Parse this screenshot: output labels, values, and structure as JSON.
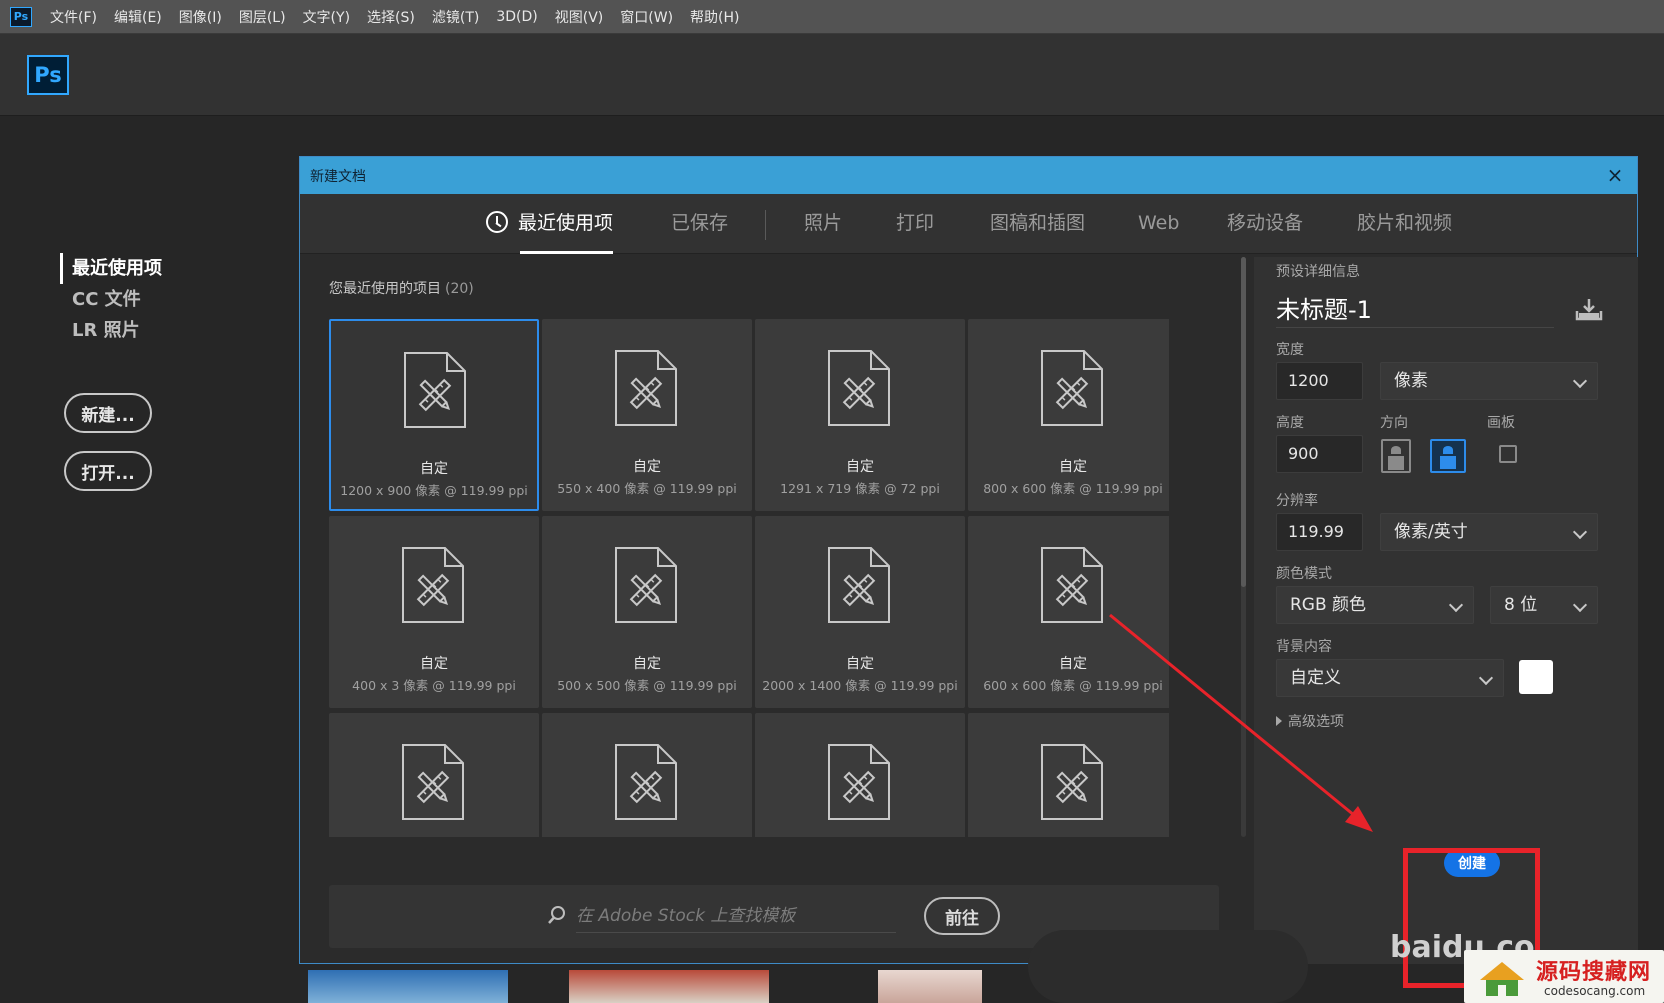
{
  "menubar": {
    "app_icon": "Ps",
    "items": [
      "文件(F)",
      "编辑(E)",
      "图像(I)",
      "图层(L)",
      "文字(Y)",
      "选择(S)",
      "滤镜(T)",
      "3D(D)",
      "视图(V)",
      "窗口(W)",
      "帮助(H)"
    ]
  },
  "app": {
    "logo": "Ps"
  },
  "start_panel": {
    "nav": [
      "最近使用项",
      "CC 文件",
      "LR 照片"
    ],
    "new_label": "新建...",
    "open_label": "打开..."
  },
  "dialog": {
    "title": "新建文档",
    "close_icon": "close-icon",
    "tabs": [
      "最近使用项",
      "已保存",
      "照片",
      "打印",
      "图稿和插图",
      "Web",
      "移动设备",
      "胶片和视频"
    ],
    "active_tab": 0,
    "recent_title": "您最近使用的项目",
    "recent_count": "(20)",
    "presets": [
      {
        "name": "自定",
        "desc": "1200 x 900 像素 @ 119.99 ppi"
      },
      {
        "name": "自定",
        "desc": "550 x 400 像素 @ 119.99 ppi"
      },
      {
        "name": "自定",
        "desc": "1291 x 719 像素 @ 72 ppi"
      },
      {
        "name": "自定",
        "desc": "800 x 600 像素 @ 119.99 ppi"
      },
      {
        "name": "自定",
        "desc": "400 x 3 像素 @ 119.99 ppi"
      },
      {
        "name": "自定",
        "desc": "500 x 500 像素 @ 119.99 ppi"
      },
      {
        "name": "自定",
        "desc": "2000 x 1400 像素 @ 119.99 ppi"
      },
      {
        "name": "自定",
        "desc": "600 x 600 像素 @ 119.99 ppi"
      },
      {
        "name": "",
        "desc": ""
      },
      {
        "name": "",
        "desc": ""
      },
      {
        "name": "",
        "desc": ""
      },
      {
        "name": "",
        "desc": ""
      }
    ],
    "search": {
      "placeholder": "在 Adobe Stock 上查找模板",
      "go_label": "前往"
    },
    "details": {
      "header": "预设详细信息",
      "doc_name": "未标题-1",
      "width_label": "宽度",
      "width_value": "1200",
      "unit": "像素",
      "height_label": "高度",
      "height_value": "900",
      "orientation_label": "方向",
      "artboard_label": "画板",
      "resolution_label": "分辨率",
      "resolution_value": "119.99",
      "resolution_unit": "像素/英寸",
      "color_mode_label": "颜色模式",
      "color_mode": "RGB 颜色",
      "bit_depth": "8 位",
      "background_label": "背景内容",
      "background": "自定义",
      "background_color": "#ffffff",
      "advanced_label": "高级选项",
      "create_label": "创建"
    }
  },
  "overlay": {
    "watermark": "baidu.co",
    "site_title": "源码搜藏网",
    "site_url": "codesocang.com",
    "arrow_color": "#e8232a"
  },
  "colors": {
    "accent": "#31a8ff",
    "title_bar": "#3aa0d6",
    "selected_border": "#2d8ceb",
    "create_button": "#1473e6"
  }
}
